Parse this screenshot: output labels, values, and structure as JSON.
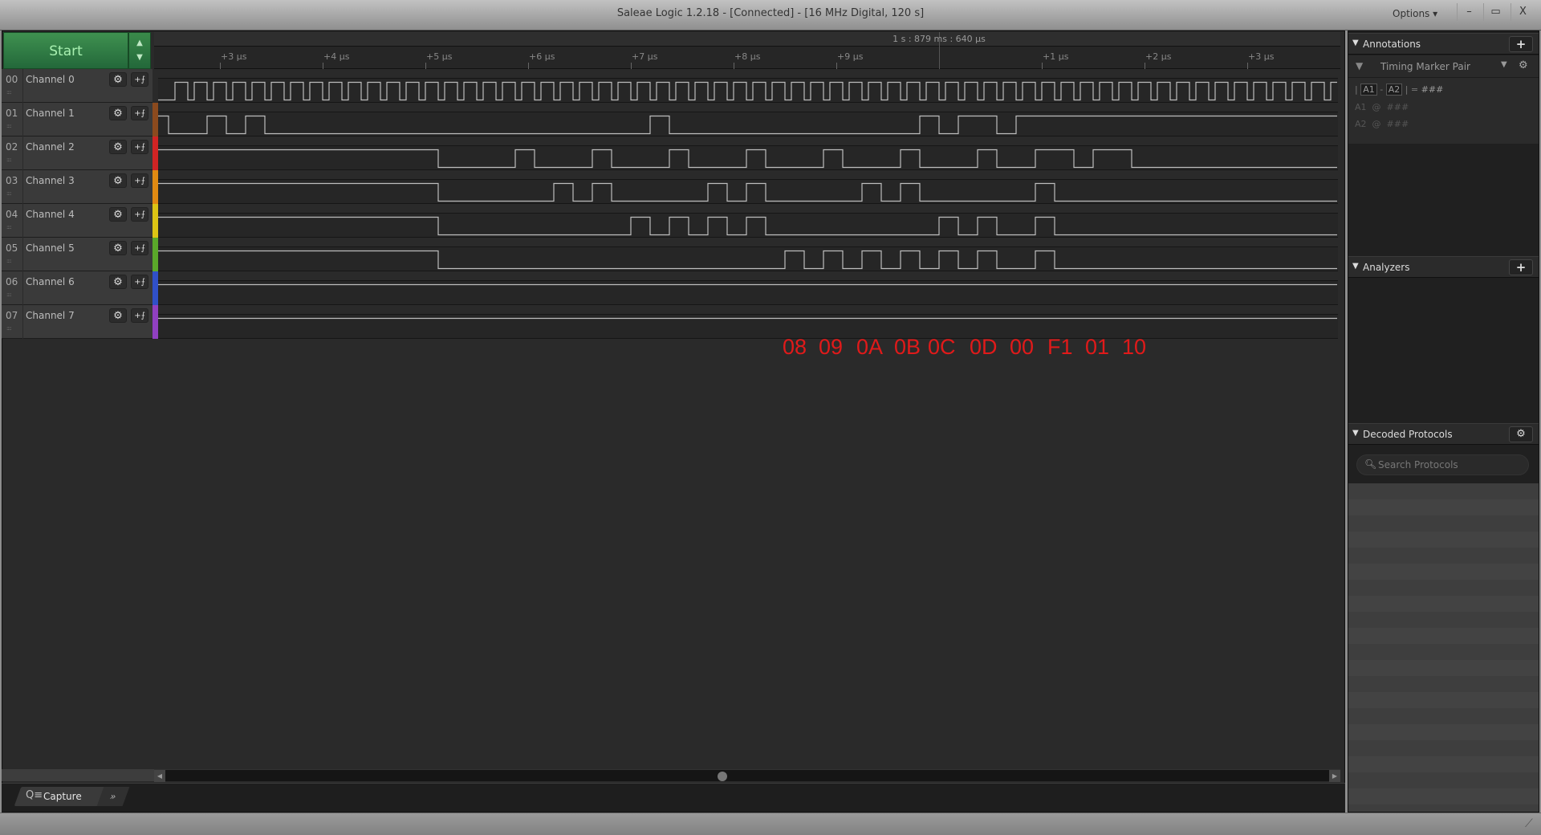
{
  "window": {
    "title": "Saleae Logic 1.2.18 - [Connected] - [16 MHz Digital, 120 s]",
    "options_label": "Options ▾",
    "minimize_icon": "–",
    "restore_icon": "▭",
    "close_icon": "X"
  },
  "controls": {
    "start_label": "Start",
    "arrow_up": "▲",
    "arrow_down": "▼"
  },
  "ruler": {
    "marker_label": "1 s : 879 ms : 640 µs",
    "marker_us": 10.0,
    "ticks": [
      {
        "label": "+3 µs",
        "t": 3
      },
      {
        "label": "+4 µs",
        "t": 4
      },
      {
        "label": "+5 µs",
        "t": 5
      },
      {
        "label": "+6 µs",
        "t": 6
      },
      {
        "label": "+7 µs",
        "t": 7
      },
      {
        "label": "+8 µs",
        "t": 8
      },
      {
        "label": "+9 µs",
        "t": 9
      },
      {
        "label": "+1 µs",
        "t": 11
      },
      {
        "label": "+2 µs",
        "t": 12
      },
      {
        "label": "+3 µs",
        "t": 13
      }
    ]
  },
  "channels": [
    {
      "num": "00",
      "name": "Channel 0",
      "color": "#2a2a2a"
    },
    {
      "num": "01",
      "name": "Channel 1",
      "color": "#8b4a1e"
    },
    {
      "num": "02",
      "name": "Channel 2",
      "color": "#d02424"
    },
    {
      "num": "03",
      "name": "Channel 3",
      "color": "#e08a12"
    },
    {
      "num": "04",
      "name": "Channel 4",
      "color": "#dcc414"
    },
    {
      "num": "05",
      "name": "Channel 5",
      "color": "#5aa82a"
    },
    {
      "num": "06",
      "name": "Channel 6",
      "color": "#3050c8"
    },
    {
      "num": "07",
      "name": "Channel 7",
      "color": "#9040c0"
    }
  ],
  "row_icons": {
    "gear": "⚙",
    "trigger": "+⨍",
    "grip": "::::"
  },
  "chart_data": {
    "type": "line",
    "x_unit": "µs",
    "view_range_us": [
      2.4,
      13.875
    ],
    "clock": {
      "channel": 0,
      "period_us": 0.1875,
      "low_us": 0.0625,
      "first_fall_us": 2.5
    },
    "signals": [
      {
        "channel": 1,
        "high": [
          [
            null,
            2.5
          ],
          [
            2.875,
            3.0625
          ],
          [
            3.25,
            3.4375
          ],
          [
            7.1875,
            7.375
          ],
          [
            9.8125,
            10.0
          ],
          [
            10.1875,
            10.5625
          ],
          [
            10.75,
            null
          ]
        ],
        "initial": "low"
      },
      {
        "channel": 2,
        "high": [
          [
            null,
            5.125
          ],
          [
            5.875,
            6.0625
          ],
          [
            6.625,
            6.8125
          ],
          [
            7.375,
            7.5625
          ],
          [
            8.125,
            8.3125
          ],
          [
            8.875,
            9.0625
          ],
          [
            9.625,
            9.8125
          ],
          [
            10.375,
            10.5625
          ],
          [
            10.9375,
            11.3125
          ],
          [
            11.5,
            11.875
          ]
        ]
      },
      {
        "channel": 3,
        "high": [
          [
            null,
            5.125
          ],
          [
            6.25,
            6.4375
          ],
          [
            6.625,
            6.8125
          ],
          [
            7.75,
            7.9375
          ],
          [
            8.125,
            8.3125
          ],
          [
            9.25,
            9.4375
          ],
          [
            9.625,
            9.8125
          ],
          [
            10.9375,
            11.125
          ]
        ]
      },
      {
        "channel": 4,
        "high": [
          [
            null,
            5.125
          ],
          [
            7.0,
            7.1875
          ],
          [
            7.375,
            7.5625
          ],
          [
            7.75,
            7.9375
          ],
          [
            8.125,
            8.3125
          ],
          [
            10.0,
            10.1875
          ],
          [
            10.375,
            10.5625
          ],
          [
            10.9375,
            11.125
          ]
        ]
      },
      {
        "channel": 5,
        "high": [
          [
            null,
            5.125
          ],
          [
            8.5,
            8.6875
          ],
          [
            8.875,
            9.0625
          ],
          [
            9.25,
            9.4375
          ],
          [
            9.625,
            9.8125
          ],
          [
            10.0,
            10.1875
          ],
          [
            10.375,
            10.5625
          ],
          [
            10.9375,
            11.125
          ]
        ]
      },
      {
        "channel": 6,
        "high": [
          [
            null,
            null
          ]
        ]
      },
      {
        "channel": 7,
        "high": [
          [
            null,
            null
          ]
        ]
      }
    ]
  },
  "annotations_overlay": {
    "color": "#e01a1a",
    "labels": [
      "08",
      "09",
      "0A",
      "0B",
      "0C",
      "0D",
      "00",
      "F1",
      "01",
      "10"
    ]
  },
  "bottom": {
    "capture_label": "Capture",
    "more_icon": "»",
    "search_icon": "Q≡"
  },
  "right_panel": {
    "annotations": {
      "title": "Annotations",
      "add": "+",
      "timing_marker": "Timing Marker Pair",
      "formula": {
        "a1": "A1",
        "a2": "A2",
        "value": "###"
      },
      "a1_line": "A1  @  ###",
      "a2_line": "A2  @  ###"
    },
    "analyzers": {
      "title": "Analyzers",
      "add": "+"
    },
    "decoded": {
      "title": "Decoded Protocols",
      "gear": "⚙",
      "search_placeholder": "Search Protocols"
    }
  }
}
